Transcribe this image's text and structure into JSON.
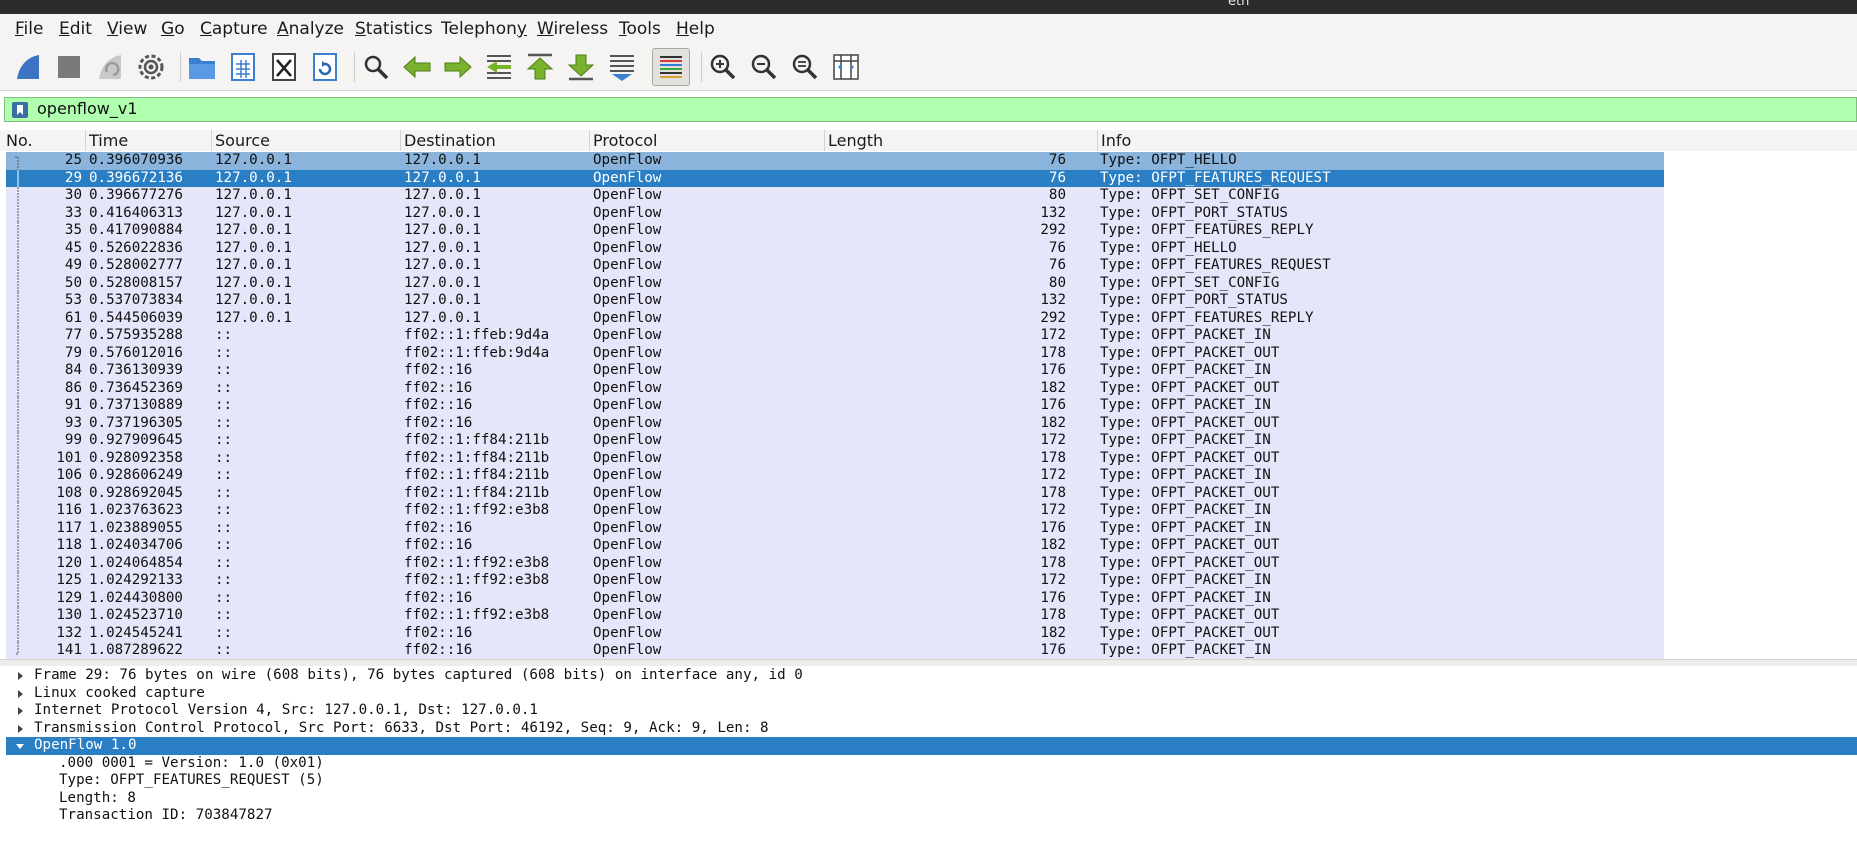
{
  "window": {
    "title": "eth"
  },
  "menu": [
    {
      "label": "File",
      "accent": "F",
      "rest": "ile"
    },
    {
      "label": "Edit",
      "accent": "E",
      "rest": "dit"
    },
    {
      "label": "View",
      "accent": "V",
      "rest": "iew"
    },
    {
      "label": "Go",
      "accent": "G",
      "rest": "o"
    },
    {
      "label": "Capture",
      "accent": "C",
      "rest": "apture"
    },
    {
      "label": "Analyze",
      "accent": "A",
      "rest": "nalyze"
    },
    {
      "label": "Statistics",
      "accent": "S",
      "rest": "tatistics"
    },
    {
      "label": "Telephony",
      "accent": "y",
      "pre": "Telephon",
      "rest": ""
    },
    {
      "label": "Wireless",
      "accent": "W",
      "rest": "ireless"
    },
    {
      "label": "Tools",
      "accent": "T",
      "rest": "ools"
    },
    {
      "label": "Help",
      "accent": "H",
      "rest": "elp"
    }
  ],
  "toolbar_icons": [
    "start-capture-icon",
    "stop-capture-icon",
    "restart-capture-icon",
    "capture-options-icon",
    "open-file-icon",
    "save-file-icon",
    "close-file-icon",
    "reload-file-icon",
    "find-packet-icon",
    "go-back-icon",
    "go-forward-icon",
    "go-to-packet-icon",
    "first-packet-icon",
    "last-packet-icon",
    "autoscroll-icon",
    "colorize-icon",
    "zoom-in-icon",
    "zoom-out-icon",
    "normal-size-icon",
    "resize-columns-icon"
  ],
  "filter": {
    "value": "openflow_v1"
  },
  "columns": [
    "No.",
    "Time",
    "Source",
    "Destination",
    "Protocol",
    "Length",
    "Info"
  ],
  "packets": [
    [
      "25",
      "0.396070936",
      "127.0.0.1",
      "127.0.0.1",
      "OpenFlow",
      "76",
      "Type: OFPT_HELLO"
    ],
    [
      "29",
      "0.396672136",
      "127.0.0.1",
      "127.0.0.1",
      "OpenFlow",
      "76",
      "Type: OFPT_FEATURES_REQUEST"
    ],
    [
      "30",
      "0.396677276",
      "127.0.0.1",
      "127.0.0.1",
      "OpenFlow",
      "80",
      "Type: OFPT_SET_CONFIG"
    ],
    [
      "33",
      "0.416406313",
      "127.0.0.1",
      "127.0.0.1",
      "OpenFlow",
      "132",
      "Type: OFPT_PORT_STATUS"
    ],
    [
      "35",
      "0.417090884",
      "127.0.0.1",
      "127.0.0.1",
      "OpenFlow",
      "292",
      "Type: OFPT_FEATURES_REPLY"
    ],
    [
      "45",
      "0.526022836",
      "127.0.0.1",
      "127.0.0.1",
      "OpenFlow",
      "76",
      "Type: OFPT_HELLO"
    ],
    [
      "49",
      "0.528002777",
      "127.0.0.1",
      "127.0.0.1",
      "OpenFlow",
      "76",
      "Type: OFPT_FEATURES_REQUEST"
    ],
    [
      "50",
      "0.528008157",
      "127.0.0.1",
      "127.0.0.1",
      "OpenFlow",
      "80",
      "Type: OFPT_SET_CONFIG"
    ],
    [
      "53",
      "0.537073834",
      "127.0.0.1",
      "127.0.0.1",
      "OpenFlow",
      "132",
      "Type: OFPT_PORT_STATUS"
    ],
    [
      "61",
      "0.544506039",
      "127.0.0.1",
      "127.0.0.1",
      "OpenFlow",
      "292",
      "Type: OFPT_FEATURES_REPLY"
    ],
    [
      "77",
      "0.575935288",
      "::",
      "ff02::1:ffeb:9d4a",
      "OpenFlow",
      "172",
      "Type: OFPT_PACKET_IN"
    ],
    [
      "79",
      "0.576012016",
      "::",
      "ff02::1:ffeb:9d4a",
      "OpenFlow",
      "178",
      "Type: OFPT_PACKET_OUT"
    ],
    [
      "84",
      "0.736130939",
      "::",
      "ff02::16",
      "OpenFlow",
      "176",
      "Type: OFPT_PACKET_IN"
    ],
    [
      "86",
      "0.736452369",
      "::",
      "ff02::16",
      "OpenFlow",
      "182",
      "Type: OFPT_PACKET_OUT"
    ],
    [
      "91",
      "0.737130889",
      "::",
      "ff02::16",
      "OpenFlow",
      "176",
      "Type: OFPT_PACKET_IN"
    ],
    [
      "93",
      "0.737196305",
      "::",
      "ff02::16",
      "OpenFlow",
      "182",
      "Type: OFPT_PACKET_OUT"
    ],
    [
      "99",
      "0.927909645",
      "::",
      "ff02::1:ff84:211b",
      "OpenFlow",
      "172",
      "Type: OFPT_PACKET_IN"
    ],
    [
      "101",
      "0.928092358",
      "::",
      "ff02::1:ff84:211b",
      "OpenFlow",
      "178",
      "Type: OFPT_PACKET_OUT"
    ],
    [
      "106",
      "0.928606249",
      "::",
      "ff02::1:ff84:211b",
      "OpenFlow",
      "172",
      "Type: OFPT_PACKET_IN"
    ],
    [
      "108",
      "0.928692045",
      "::",
      "ff02::1:ff84:211b",
      "OpenFlow",
      "178",
      "Type: OFPT_PACKET_OUT"
    ],
    [
      "116",
      "1.023763623",
      "::",
      "ff02::1:ff92:e3b8",
      "OpenFlow",
      "172",
      "Type: OFPT_PACKET_IN"
    ],
    [
      "117",
      "1.023889055",
      "::",
      "ff02::16",
      "OpenFlow",
      "176",
      "Type: OFPT_PACKET_IN"
    ],
    [
      "118",
      "1.024034706",
      "::",
      "ff02::16",
      "OpenFlow",
      "182",
      "Type: OFPT_PACKET_OUT"
    ],
    [
      "120",
      "1.024064854",
      "::",
      "ff02::1:ff92:e3b8",
      "OpenFlow",
      "178",
      "Type: OFPT_PACKET_OUT"
    ],
    [
      "125",
      "1.024292133",
      "::",
      "ff02::1:ff92:e3b8",
      "OpenFlow",
      "172",
      "Type: OFPT_PACKET_IN"
    ],
    [
      "129",
      "1.024430800",
      "::",
      "ff02::16",
      "OpenFlow",
      "176",
      "Type: OFPT_PACKET_IN"
    ],
    [
      "130",
      "1.024523710",
      "::",
      "ff02::1:ff92:e3b8",
      "OpenFlow",
      "178",
      "Type: OFPT_PACKET_OUT"
    ],
    [
      "132",
      "1.024545241",
      "::",
      "ff02::16",
      "OpenFlow",
      "182",
      "Type: OFPT_PACKET_OUT"
    ],
    [
      "141",
      "1.087289622",
      "::",
      "ff02::16",
      "OpenFlow",
      "176",
      "Type: OFPT_PACKET_IN"
    ]
  ],
  "highlighted_row": 0,
  "selected_row": 1,
  "details": [
    {
      "text": "Frame 29: 76 bytes on wire (608 bits), 76 bytes captured (608 bits) on interface any, id 0",
      "level": 0,
      "expanded": false,
      "selected": false
    },
    {
      "text": "Linux cooked capture",
      "level": 0,
      "expanded": false,
      "selected": false
    },
    {
      "text": "Internet Protocol Version 4, Src: 127.0.0.1, Dst: 127.0.0.1",
      "level": 0,
      "expanded": false,
      "selected": false
    },
    {
      "text": "Transmission Control Protocol, Src Port: 6633, Dst Port: 46192, Seq: 9, Ack: 9, Len: 8",
      "level": 0,
      "expanded": false,
      "selected": false
    },
    {
      "text": "OpenFlow 1.0",
      "level": 0,
      "expanded": true,
      "selected": true
    },
    {
      "text": ".000 0001 = Version: 1.0 (0x01)",
      "level": 1
    },
    {
      "text": "Type: OFPT_FEATURES_REQUEST (5)",
      "level": 1
    },
    {
      "text": "Length: 8",
      "level": 1
    },
    {
      "text": "Transaction ID: 703847827",
      "level": 1
    }
  ],
  "colors": {
    "filter_bg": "#afffaf",
    "row_bg": "#e6e6fa",
    "row_highlight": "#8ab4db",
    "row_selected": "#2a7fc4"
  }
}
